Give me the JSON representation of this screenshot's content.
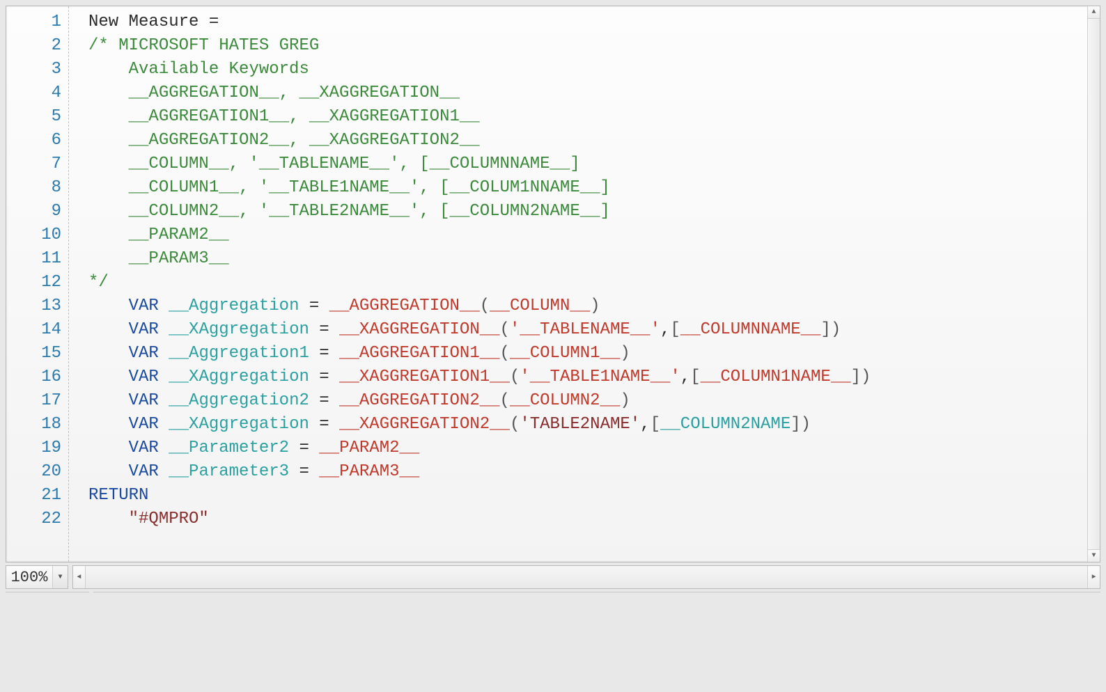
{
  "zoom": {
    "value": "100%"
  },
  "line_count": 22,
  "code": {
    "lines": [
      [
        {
          "text": "New Measure = ",
          "cls": "tok-default"
        }
      ],
      [
        {
          "text": "/* MICROSOFT HATES GREG",
          "cls": "tok-comment"
        }
      ],
      [
        {
          "text": "    Available Keywords",
          "cls": "tok-comment"
        }
      ],
      [
        {
          "text": "    __AGGREGATION__, __XAGGREGATION__",
          "cls": "tok-comment"
        }
      ],
      [
        {
          "text": "    __AGGREGATION1__, __XAGGREGATION1__",
          "cls": "tok-comment"
        }
      ],
      [
        {
          "text": "    __AGGREGATION2__, __XAGGREGATION2__",
          "cls": "tok-comment"
        }
      ],
      [
        {
          "text": "    __COLUMN__, '__TABLENAME__', [__COLUMNNAME__]",
          "cls": "tok-comment"
        }
      ],
      [
        {
          "text": "    __COLUMN1__, '__TABLE1NAME__', [__COLUM1NNAME__]",
          "cls": "tok-comment"
        }
      ],
      [
        {
          "text": "    __COLUMN2__, '__TABLE2NAME__', [__COLUMN2NAME__]",
          "cls": "tok-comment"
        }
      ],
      [
        {
          "text": "    __PARAM2__",
          "cls": "tok-comment"
        }
      ],
      [
        {
          "text": "    __PARAM3__",
          "cls": "tok-comment"
        }
      ],
      [
        {
          "text": "*/",
          "cls": "tok-comment"
        }
      ],
      [
        {
          "text": "    ",
          "cls": "tok-default"
        },
        {
          "text": "VAR",
          "cls": "tok-keyword"
        },
        {
          "text": " ",
          "cls": "tok-default"
        },
        {
          "text": "__Aggregation",
          "cls": "tok-ident"
        },
        {
          "text": " = ",
          "cls": "tok-default"
        },
        {
          "text": "__AGGREGATION__",
          "cls": "tok-func"
        },
        {
          "text": "(",
          "cls": "tok-paren"
        },
        {
          "text": "__COLUMN__",
          "cls": "tok-func"
        },
        {
          "text": ")",
          "cls": "tok-paren"
        }
      ],
      [
        {
          "text": "    ",
          "cls": "tok-default"
        },
        {
          "text": "VAR",
          "cls": "tok-keyword"
        },
        {
          "text": " ",
          "cls": "tok-default"
        },
        {
          "text": "__XAggregation",
          "cls": "tok-ident"
        },
        {
          "text": " = ",
          "cls": "tok-default"
        },
        {
          "text": "__XAGGREGATION__",
          "cls": "tok-func"
        },
        {
          "text": "(",
          "cls": "tok-paren"
        },
        {
          "text": "'__TABLENAME__'",
          "cls": "tok-func"
        },
        {
          "text": ",",
          "cls": "tok-default"
        },
        {
          "text": "[",
          "cls": "tok-paren"
        },
        {
          "text": "__COLUMNNAME__",
          "cls": "tok-func"
        },
        {
          "text": "])",
          "cls": "tok-paren"
        }
      ],
      [
        {
          "text": "    ",
          "cls": "tok-default"
        },
        {
          "text": "VAR",
          "cls": "tok-keyword"
        },
        {
          "text": " ",
          "cls": "tok-default"
        },
        {
          "text": "__Aggregation1",
          "cls": "tok-ident"
        },
        {
          "text": " = ",
          "cls": "tok-default"
        },
        {
          "text": "__AGGREGATION1__",
          "cls": "tok-func"
        },
        {
          "text": "(",
          "cls": "tok-paren"
        },
        {
          "text": "__COLUMN1__",
          "cls": "tok-func"
        },
        {
          "text": ")",
          "cls": "tok-paren"
        }
      ],
      [
        {
          "text": "    ",
          "cls": "tok-default"
        },
        {
          "text": "VAR",
          "cls": "tok-keyword"
        },
        {
          "text": " ",
          "cls": "tok-default"
        },
        {
          "text": "__XAggregation",
          "cls": "tok-ident"
        },
        {
          "text": " = ",
          "cls": "tok-default"
        },
        {
          "text": "__XAGGREGATION1__",
          "cls": "tok-func"
        },
        {
          "text": "(",
          "cls": "tok-paren"
        },
        {
          "text": "'__TABLE1NAME__'",
          "cls": "tok-func"
        },
        {
          "text": ",",
          "cls": "tok-default"
        },
        {
          "text": "[",
          "cls": "tok-paren"
        },
        {
          "text": "__COLUMN1NAME__",
          "cls": "tok-func"
        },
        {
          "text": "])",
          "cls": "tok-paren"
        }
      ],
      [
        {
          "text": "    ",
          "cls": "tok-default"
        },
        {
          "text": "VAR",
          "cls": "tok-keyword"
        },
        {
          "text": " ",
          "cls": "tok-default"
        },
        {
          "text": "__Aggregation2",
          "cls": "tok-ident"
        },
        {
          "text": " = ",
          "cls": "tok-default"
        },
        {
          "text": "__AGGREGATION2__",
          "cls": "tok-func"
        },
        {
          "text": "(",
          "cls": "tok-paren"
        },
        {
          "text": "__COLUMN2__",
          "cls": "tok-func"
        },
        {
          "text": ")",
          "cls": "tok-paren"
        }
      ],
      [
        {
          "text": "    ",
          "cls": "tok-default"
        },
        {
          "text": "VAR",
          "cls": "tok-keyword"
        },
        {
          "text": " ",
          "cls": "tok-default"
        },
        {
          "text": "__XAggregation",
          "cls": "tok-ident"
        },
        {
          "text": " = ",
          "cls": "tok-default"
        },
        {
          "text": "__XAGGREGATION2__",
          "cls": "tok-func"
        },
        {
          "text": "(",
          "cls": "tok-paren"
        },
        {
          "text": "'TABLE2NAME'",
          "cls": "tok-string"
        },
        {
          "text": ",",
          "cls": "tok-default"
        },
        {
          "text": "[",
          "cls": "tok-paren"
        },
        {
          "text": "__COLUMN2NAME",
          "cls": "tok-colref"
        },
        {
          "text": "])",
          "cls": "tok-paren"
        }
      ],
      [
        {
          "text": "    ",
          "cls": "tok-default"
        },
        {
          "text": "VAR",
          "cls": "tok-keyword"
        },
        {
          "text": " ",
          "cls": "tok-default"
        },
        {
          "text": "__Parameter2",
          "cls": "tok-ident"
        },
        {
          "text": " = ",
          "cls": "tok-default"
        },
        {
          "text": "__PARAM2__",
          "cls": "tok-func"
        }
      ],
      [
        {
          "text": "    ",
          "cls": "tok-default"
        },
        {
          "text": "VAR",
          "cls": "tok-keyword"
        },
        {
          "text": " ",
          "cls": "tok-default"
        },
        {
          "text": "__Parameter3",
          "cls": "tok-ident"
        },
        {
          "text": " = ",
          "cls": "tok-default"
        },
        {
          "text": "__PARAM3__",
          "cls": "tok-func"
        }
      ],
      [
        {
          "text": "RETURN",
          "cls": "tok-keyword"
        }
      ],
      [
        {
          "text": "    ",
          "cls": "tok-default"
        },
        {
          "text": "\"#QMPRO\"",
          "cls": "tok-string"
        }
      ]
    ]
  }
}
